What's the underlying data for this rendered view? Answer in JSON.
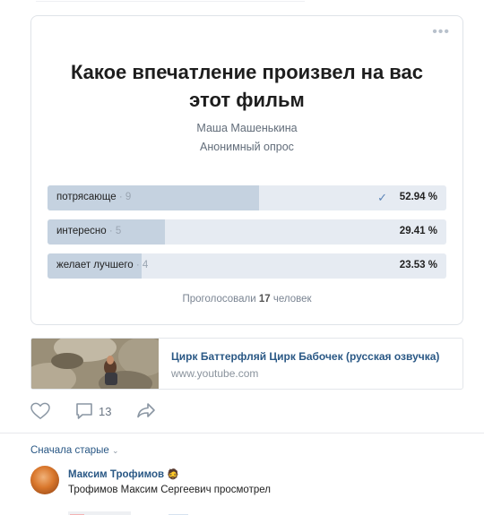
{
  "poll": {
    "title": "Какое впечатление произвел на вас этот фильм",
    "author": "Маша Машенькина",
    "type": "Анонимный опрос",
    "answers": [
      {
        "text": "потрясающе",
        "count": "· 9",
        "percent_label": "52.94 %",
        "fraction": 0.5294,
        "checked": true
      },
      {
        "text": "интересно",
        "count": "· 5",
        "percent_label": "29.41 %",
        "fraction": 0.2941,
        "checked": false
      },
      {
        "text": "желает лучшего",
        "count": "· 4",
        "percent_label": "23.53 %",
        "fraction": 0.2353,
        "checked": false
      }
    ],
    "voted_prefix": "Проголосовали",
    "voted_count": "17",
    "voted_suffix": "человек"
  },
  "link": {
    "title": "Цирк Баттерфляй Цирк Бабочек (русская озвучка)",
    "url": "www.youtube.com"
  },
  "actions": {
    "comment_count": "13"
  },
  "comments": {
    "sort_label": "Сначала старые",
    "items": [
      {
        "author": "Максим Трофимов",
        "author_emoji": "🧔",
        "text": "Трофимов Максим Сергеевич просмотрел"
      }
    ]
  },
  "colors": {
    "link": "#2a5885",
    "bar_bg": "#e6ebf2",
    "bar_fill": "#c5d2e0",
    "check": "#5c84b8"
  }
}
